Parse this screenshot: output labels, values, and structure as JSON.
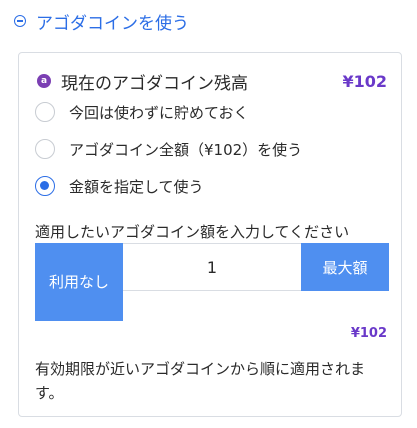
{
  "header": {
    "title": "アゴダコインを使う",
    "icon": "collapse-circle-minus"
  },
  "balance": {
    "label": "現在のアゴダコイン残高",
    "value": "¥102",
    "icon": "agoda-coin"
  },
  "options": [
    {
      "label": "今回は使わずに貯めておく",
      "checked": false
    },
    {
      "label": "アゴダコイン全額（¥102）を使う",
      "checked": false
    },
    {
      "label": "金額を指定して使う",
      "checked": true
    }
  ],
  "amount": {
    "hint": "適用したいアゴダコイン額を入力してください",
    "none_label": "利用なし",
    "value": "1",
    "max_label": "最大額",
    "applied": "¥102"
  },
  "note": "有効期限が近いアゴダコインから順に適用されます。",
  "colors": {
    "accent": "#2c6ee6",
    "button": "#4f8ff0",
    "coin": "#6a39c9"
  }
}
